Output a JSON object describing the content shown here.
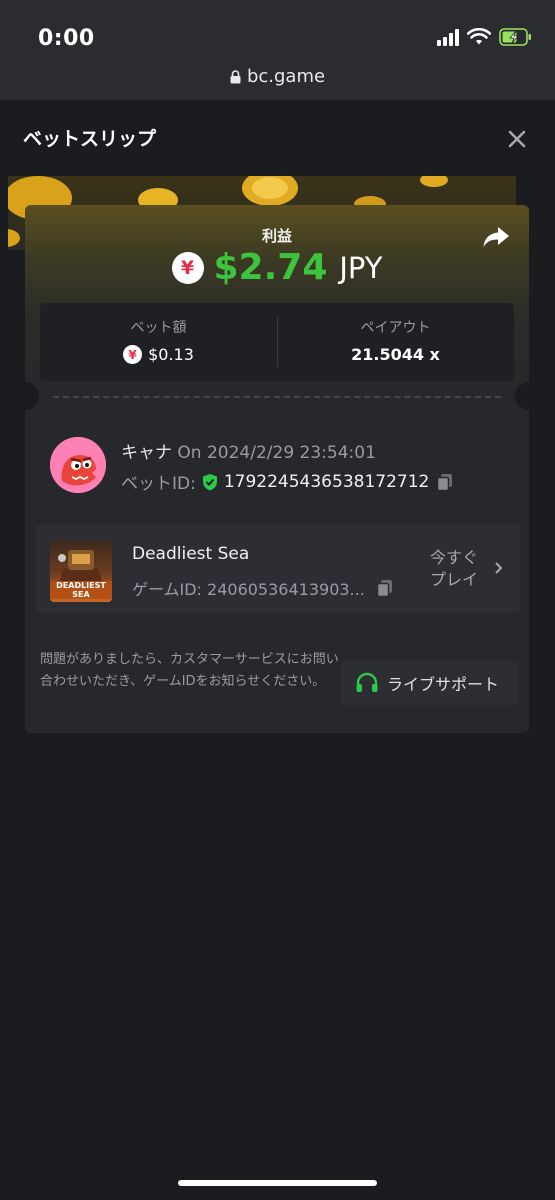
{
  "status_bar": {
    "time": "0:00",
    "url": "bc.game"
  },
  "sheet": {
    "title": "ベットスリップ"
  },
  "profit": {
    "label": "利益",
    "currency_symbol": "¥",
    "amount": "$2.74",
    "currency": "JPY"
  },
  "stats": {
    "bet_amount_label": "ベット額",
    "bet_amount_symbol": "¥",
    "bet_amount_value": "$0.13",
    "payout_label": "ペイアウト",
    "payout_value": "21.5044 x"
  },
  "bet": {
    "user": "キャナ",
    "on": "On 2024/2/29 23:54:01",
    "id_label": "ベットID:",
    "id_value": "1792245436538172712"
  },
  "game": {
    "name": "Deadliest Sea",
    "thumb_text": "DEADLIEST SEA",
    "id_text": "ゲームID: 24060536413903...",
    "play_line1": "今すぐ",
    "play_line2": "プレイ"
  },
  "footer": {
    "help_text": "問題がありましたら、カスタマーサービスにお問い合わせいただき、ゲームIDをお知らせください。",
    "support_label": "ライブサポート"
  },
  "colors": {
    "profit_green": "#3dc43d",
    "accent_pink": "#ff80b5",
    "background": "#1b1c1f",
    "card": "#27282c"
  },
  "icons": [
    "lock-icon",
    "wifi-icon",
    "battery-icon",
    "close-icon",
    "share-icon",
    "copy-icon",
    "shield-check-icon",
    "chevron-right-icon",
    "headset-icon"
  ]
}
